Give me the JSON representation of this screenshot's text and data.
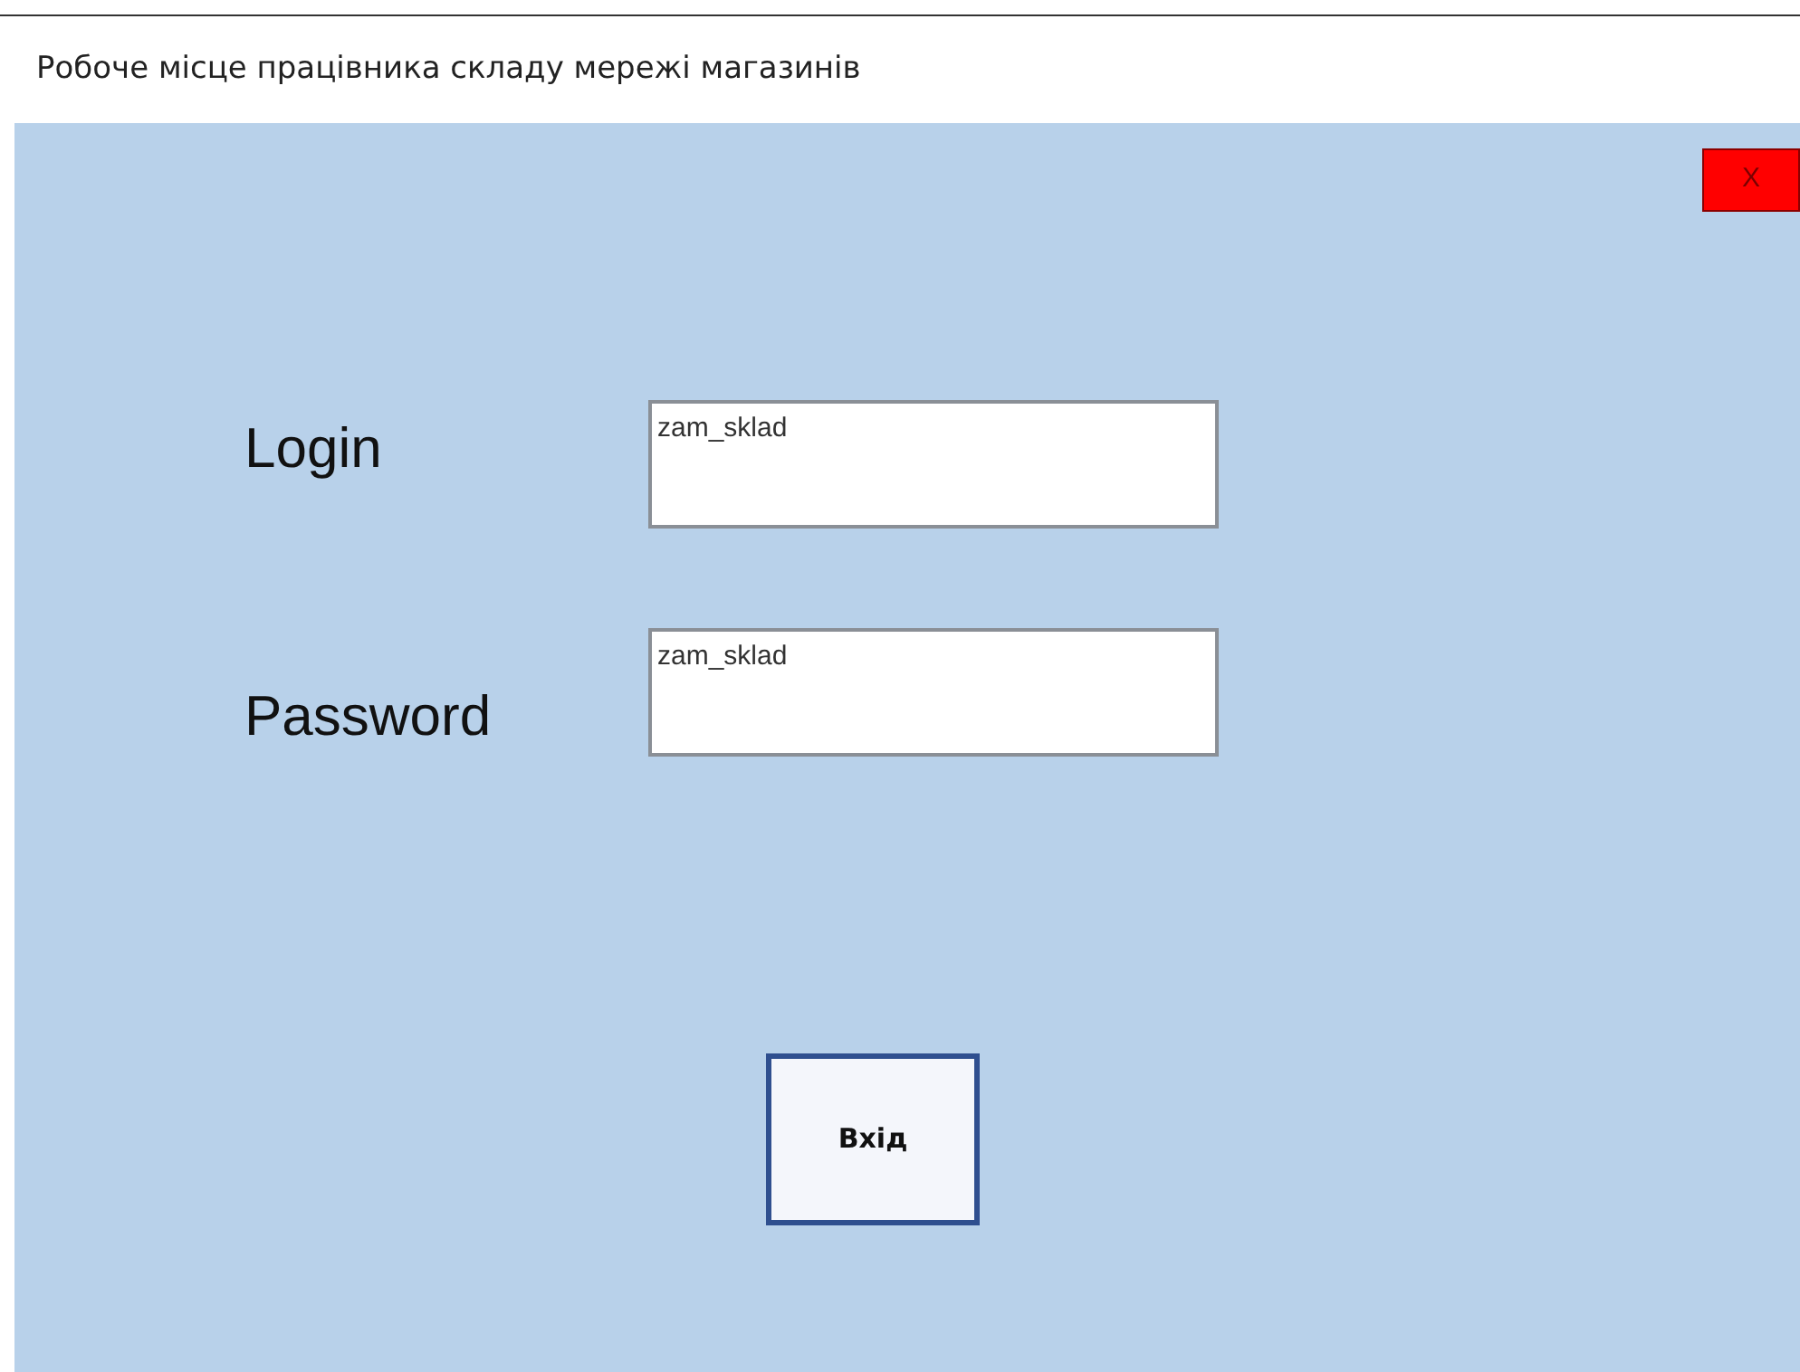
{
  "window": {
    "title": "Робоче місце працівника складу мережі магазинів"
  },
  "close_button": {
    "label": "X"
  },
  "fields": [
    {
      "label": "Login",
      "value": "zam_sklad"
    },
    {
      "label": "Password",
      "value": "zam_sklad"
    }
  ],
  "submit_button": {
    "label": "Вхід"
  }
}
